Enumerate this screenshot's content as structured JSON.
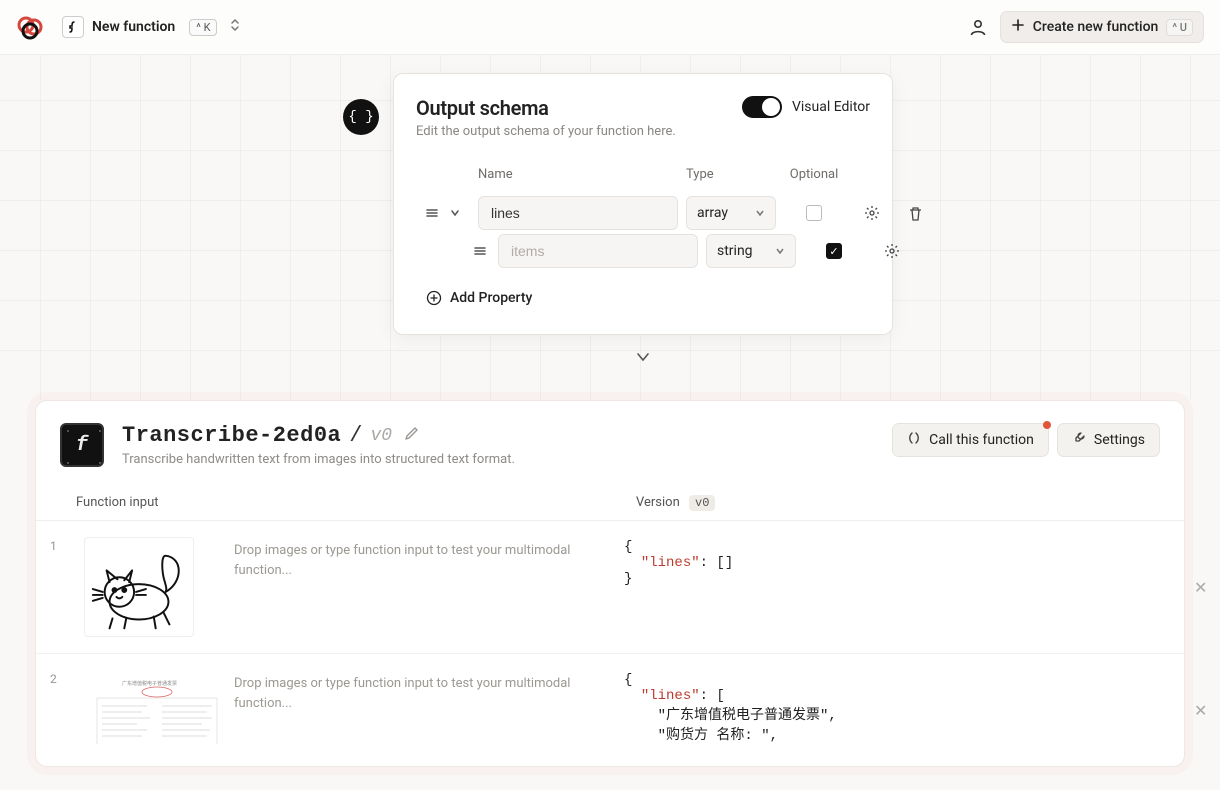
{
  "topbar": {
    "breadcrumb_label": "New function",
    "shortcut_search": "^ K",
    "create_label": "Create new function",
    "create_shortcut": "^ U"
  },
  "schema_panel": {
    "title": "Output schema",
    "subtitle": "Edit the output schema of your function here.",
    "toggle_label": "Visual Editor",
    "toggle_on": true,
    "columns": {
      "name": "Name",
      "type": "Type",
      "optional": "Optional"
    },
    "rows": [
      {
        "name": "lines",
        "type": "array",
        "optional": false,
        "has_children": true,
        "has_delete": true
      },
      {
        "name_placeholder": "items",
        "type": "string",
        "optional": true,
        "indented": true
      }
    ],
    "add_property_label": "Add Property"
  },
  "detail": {
    "title": "Transcribe-2ed0a",
    "version": "v0",
    "description": "Transcribe handwritten text from images into structured text format.",
    "call_button": "Call this function",
    "settings_button": "Settings",
    "columns": {
      "input": "Function input",
      "version_label": "Version",
      "version_value": "v0"
    }
  },
  "examples": [
    {
      "index": "1",
      "placeholder": "Drop images or type function input to test your multimodal function...",
      "output_html": "{\n  <span class=\"key\">\"lines\"</span>: []\n}"
    },
    {
      "index": "2",
      "placeholder": "Drop images or type function input to test your multimodal function...",
      "output_html": "{\n  <span class=\"key\">\"lines\"</span>: [\n    \"广东增值税电子普通发票\",\n    \"购货方 名称: \","
    }
  ]
}
